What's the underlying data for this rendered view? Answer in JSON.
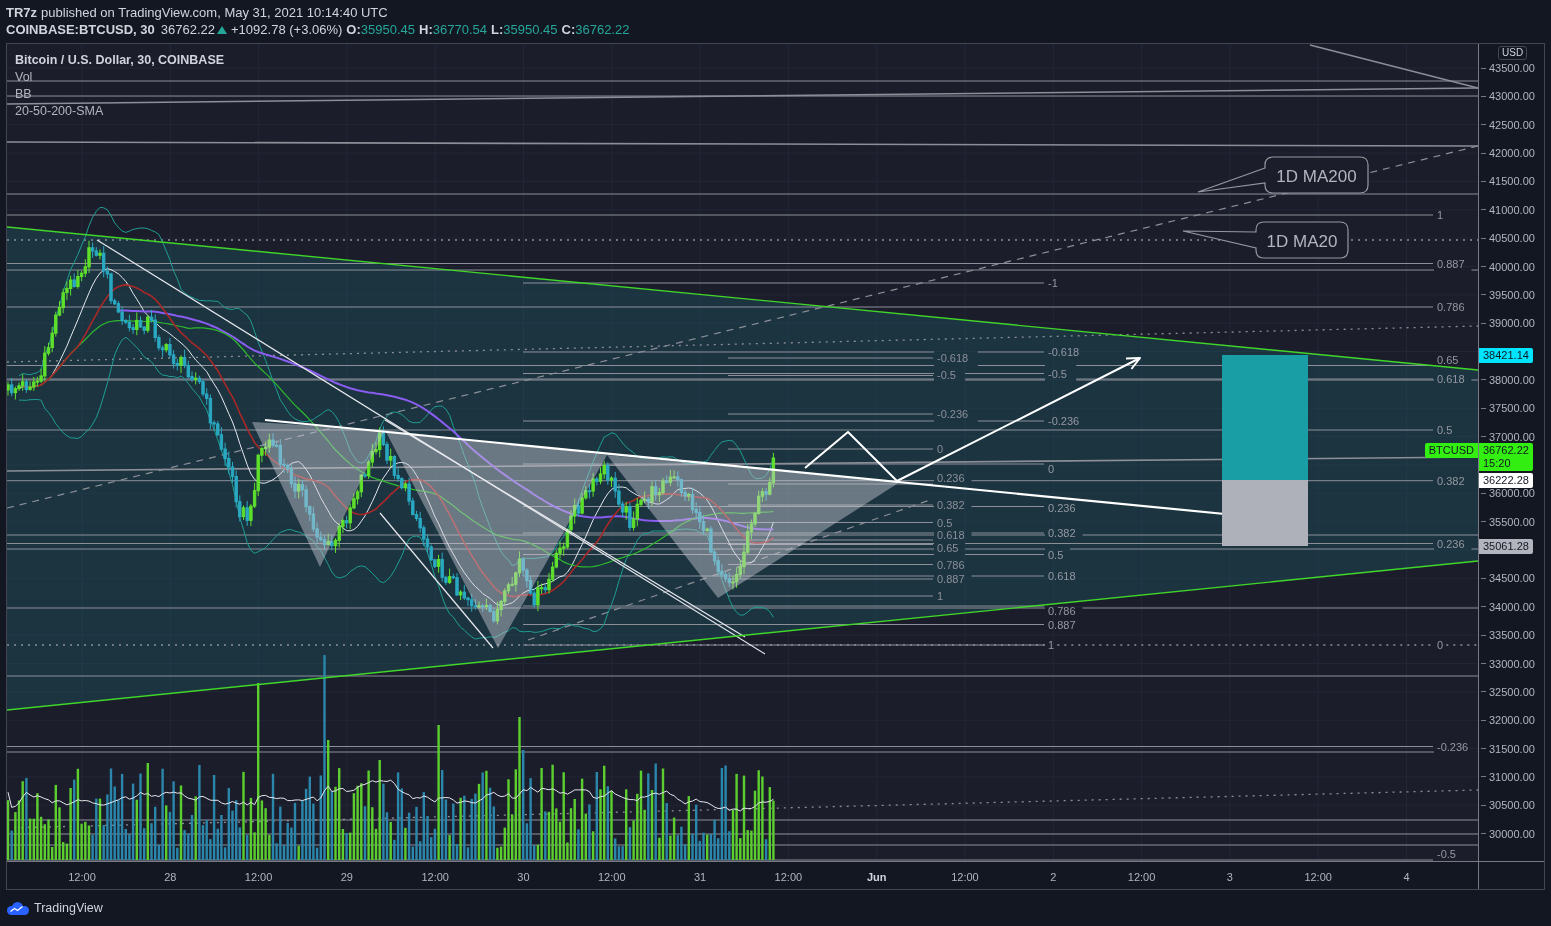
{
  "header": {
    "author": "TR7z",
    "published": "published on TradingView.com, May 31, 2021 10:14:40 UTC"
  },
  "symbol_bar": {
    "symbol": "COINBASE:BTCUSD, 30",
    "last": "36762.22",
    "rising": true,
    "change": "+1092.78 (+3.06%)",
    "ohlc": [
      {
        "label": "O:",
        "value": "35950.45"
      },
      {
        "label": "H:",
        "value": "36770.54"
      },
      {
        "label": "L:",
        "value": "35950.45"
      },
      {
        "label": "C:",
        "value": "36762.22"
      }
    ]
  },
  "legend": {
    "title": "Bitcoin / U.S. Dollar, 30, COINBASE",
    "indicators": [
      "Vol",
      "BB",
      "20-50-200-SMA"
    ]
  },
  "callouts": [
    {
      "text": "1D MA200"
    },
    {
      "text": "1D MA20"
    }
  ],
  "fib_retracements": [
    {
      "labels": [
        "-0.618",
        "-0.5",
        "-0.236",
        "0",
        "0.236",
        "0.382",
        "0.5",
        "0.618",
        "0.65",
        "0.786",
        "0.887",
        "1"
      ]
    },
    {
      "labels": [
        "-1",
        "-0.618",
        "-0.5",
        "-0.236",
        "0",
        "0.236",
        "0.382",
        "0.5",
        "0.618",
        "0.786",
        "0.887",
        "1"
      ]
    },
    {
      "labels": [
        "1",
        "0.887",
        "0.786",
        "0.65",
        "0.618",
        "0.5",
        "0.382",
        "0.236",
        "0",
        "-0.236",
        "-0.5"
      ]
    }
  ],
  "price_axis": {
    "currency": "USD",
    "ticks": [
      "43500.00",
      "43000.00",
      "42500.00",
      "42000.00",
      "41500.00",
      "41000.00",
      "40500.00",
      "40000.00",
      "39500.00",
      "39000.00",
      "38000.00",
      "37500.00",
      "37000.00",
      "36000.00",
      "35500.00",
      "34500.00",
      "34000.00",
      "33500.00",
      "33000.00",
      "32500.00",
      "32000.00",
      "31500.00",
      "31000.00",
      "30500.00",
      "30000.00"
    ]
  },
  "price_badges": [
    {
      "kind": "price",
      "price": "38421.14",
      "color": "#00e5ff"
    },
    {
      "kind": "symbol",
      "symbol": "BTCUSD",
      "price": "36762.22",
      "countdown": "15:20",
      "color": "#33ee11"
    },
    {
      "kind": "price",
      "price": "36222.28",
      "color": "#ffffff"
    },
    {
      "kind": "price",
      "price": "35061.28",
      "color": "#b2b5be"
    }
  ],
  "time_axis": {
    "ticks": [
      {
        "label": "12:00",
        "kind": "time"
      },
      {
        "label": "28",
        "kind": "day"
      },
      {
        "label": "12:00",
        "kind": "time"
      },
      {
        "label": "29",
        "kind": "day"
      },
      {
        "label": "12:00",
        "kind": "time"
      },
      {
        "label": "30",
        "kind": "day"
      },
      {
        "label": "12:00",
        "kind": "time"
      },
      {
        "label": "31",
        "kind": "day"
      },
      {
        "label": "12:00",
        "kind": "time"
      },
      {
        "label": "Jun",
        "kind": "month"
      },
      {
        "label": "12:00",
        "kind": "time"
      },
      {
        "label": "2",
        "kind": "day"
      },
      {
        "label": "12:00",
        "kind": "time"
      },
      {
        "label": "3",
        "kind": "day"
      },
      {
        "label": "12:00",
        "kind": "time"
      },
      {
        "label": "4",
        "kind": "day"
      }
    ]
  },
  "footer": {
    "brand": "TradingView"
  }
}
